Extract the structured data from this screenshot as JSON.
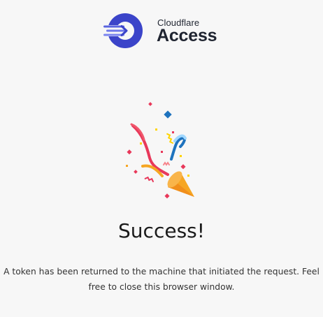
{
  "brand": {
    "line1": "Cloudflare",
    "line2": "Access",
    "icon": "cloudflare-access-logo-icon",
    "color_dark": "#3b44c9",
    "color_light": "#7a84ef",
    "text_color": "#1f2430"
  },
  "illustration": {
    "icon": "party-popper-icon",
    "colors": [
      "#f6a623",
      "#e8385a",
      "#1e73be",
      "#a0d8ff",
      "#ffd400"
    ]
  },
  "status": {
    "title": "Success!",
    "message_line1": "A token has been returned to the machine that initiated the request. Feel",
    "message_line2": "free to close this browser window."
  },
  "background": "#f7f7f7"
}
